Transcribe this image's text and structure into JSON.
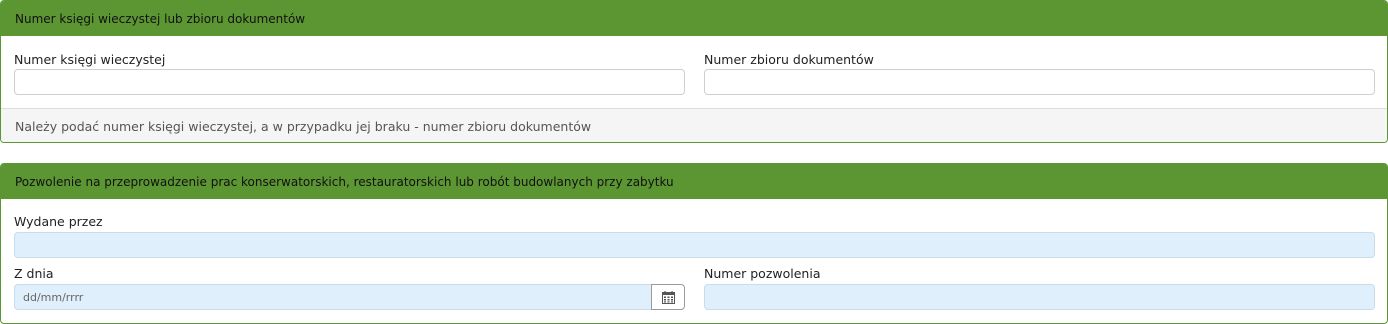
{
  "land_register": {
    "header_title": "Numer księgi wieczystej lub zbioru dokumentów",
    "kw_label": "Numer księgi wieczystej",
    "kw_value": "",
    "docs_label": "Numer zbioru dokumentów",
    "docs_value": "",
    "help_text": "Należy podać numer księgi wieczystej, a w przypadku jej braku - numer zbioru dokumentów"
  },
  "permit": {
    "header_title": "Pozwolenie na przeprowadzenie prac konserwatorskich, restauratorskich lub robót budowlanych przy zabytku",
    "issued_by_label": "Wydane przez",
    "issued_by_value": "",
    "date_label": "Z dnia",
    "date_placeholder": "dd/mm/rrrr",
    "permit_number_label": "Numer pozwolenia",
    "permit_number_value": ""
  },
  "icons": {
    "date_picker": "calendar-icon"
  },
  "colors": {
    "header_green": "#5c9632",
    "field_blue": "#dff0fc",
    "help_bg": "#f5f5f5"
  }
}
